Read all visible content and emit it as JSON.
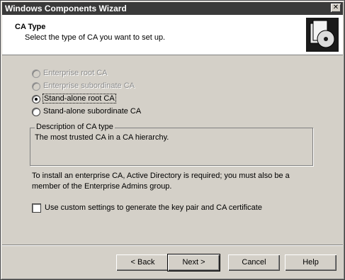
{
  "window": {
    "title": "Windows Components Wizard",
    "close_label": "✕"
  },
  "header": {
    "title": "CA Type",
    "subtitle": "Select the type of CA you want to set up."
  },
  "options": [
    {
      "label": "Enterprise root CA",
      "selected": false,
      "enabled": false
    },
    {
      "label": "Enterprise subordinate CA",
      "selected": false,
      "enabled": false
    },
    {
      "label": "Stand-alone root CA",
      "selected": true,
      "enabled": true
    },
    {
      "label": "Stand-alone subordinate CA",
      "selected": false,
      "enabled": true
    }
  ],
  "description": {
    "legend": "Description of CA type",
    "text": "The most trusted CA in a CA hierarchy."
  },
  "note": "To install an enterprise CA, Active Directory is required; you must also be a member of the Enterprise Admins group.",
  "custom_settings": {
    "label": "Use custom settings to generate the key pair and CA certificate",
    "checked": false
  },
  "buttons": {
    "back": "< Back",
    "next": "Next >",
    "cancel": "Cancel",
    "help": "Help"
  }
}
